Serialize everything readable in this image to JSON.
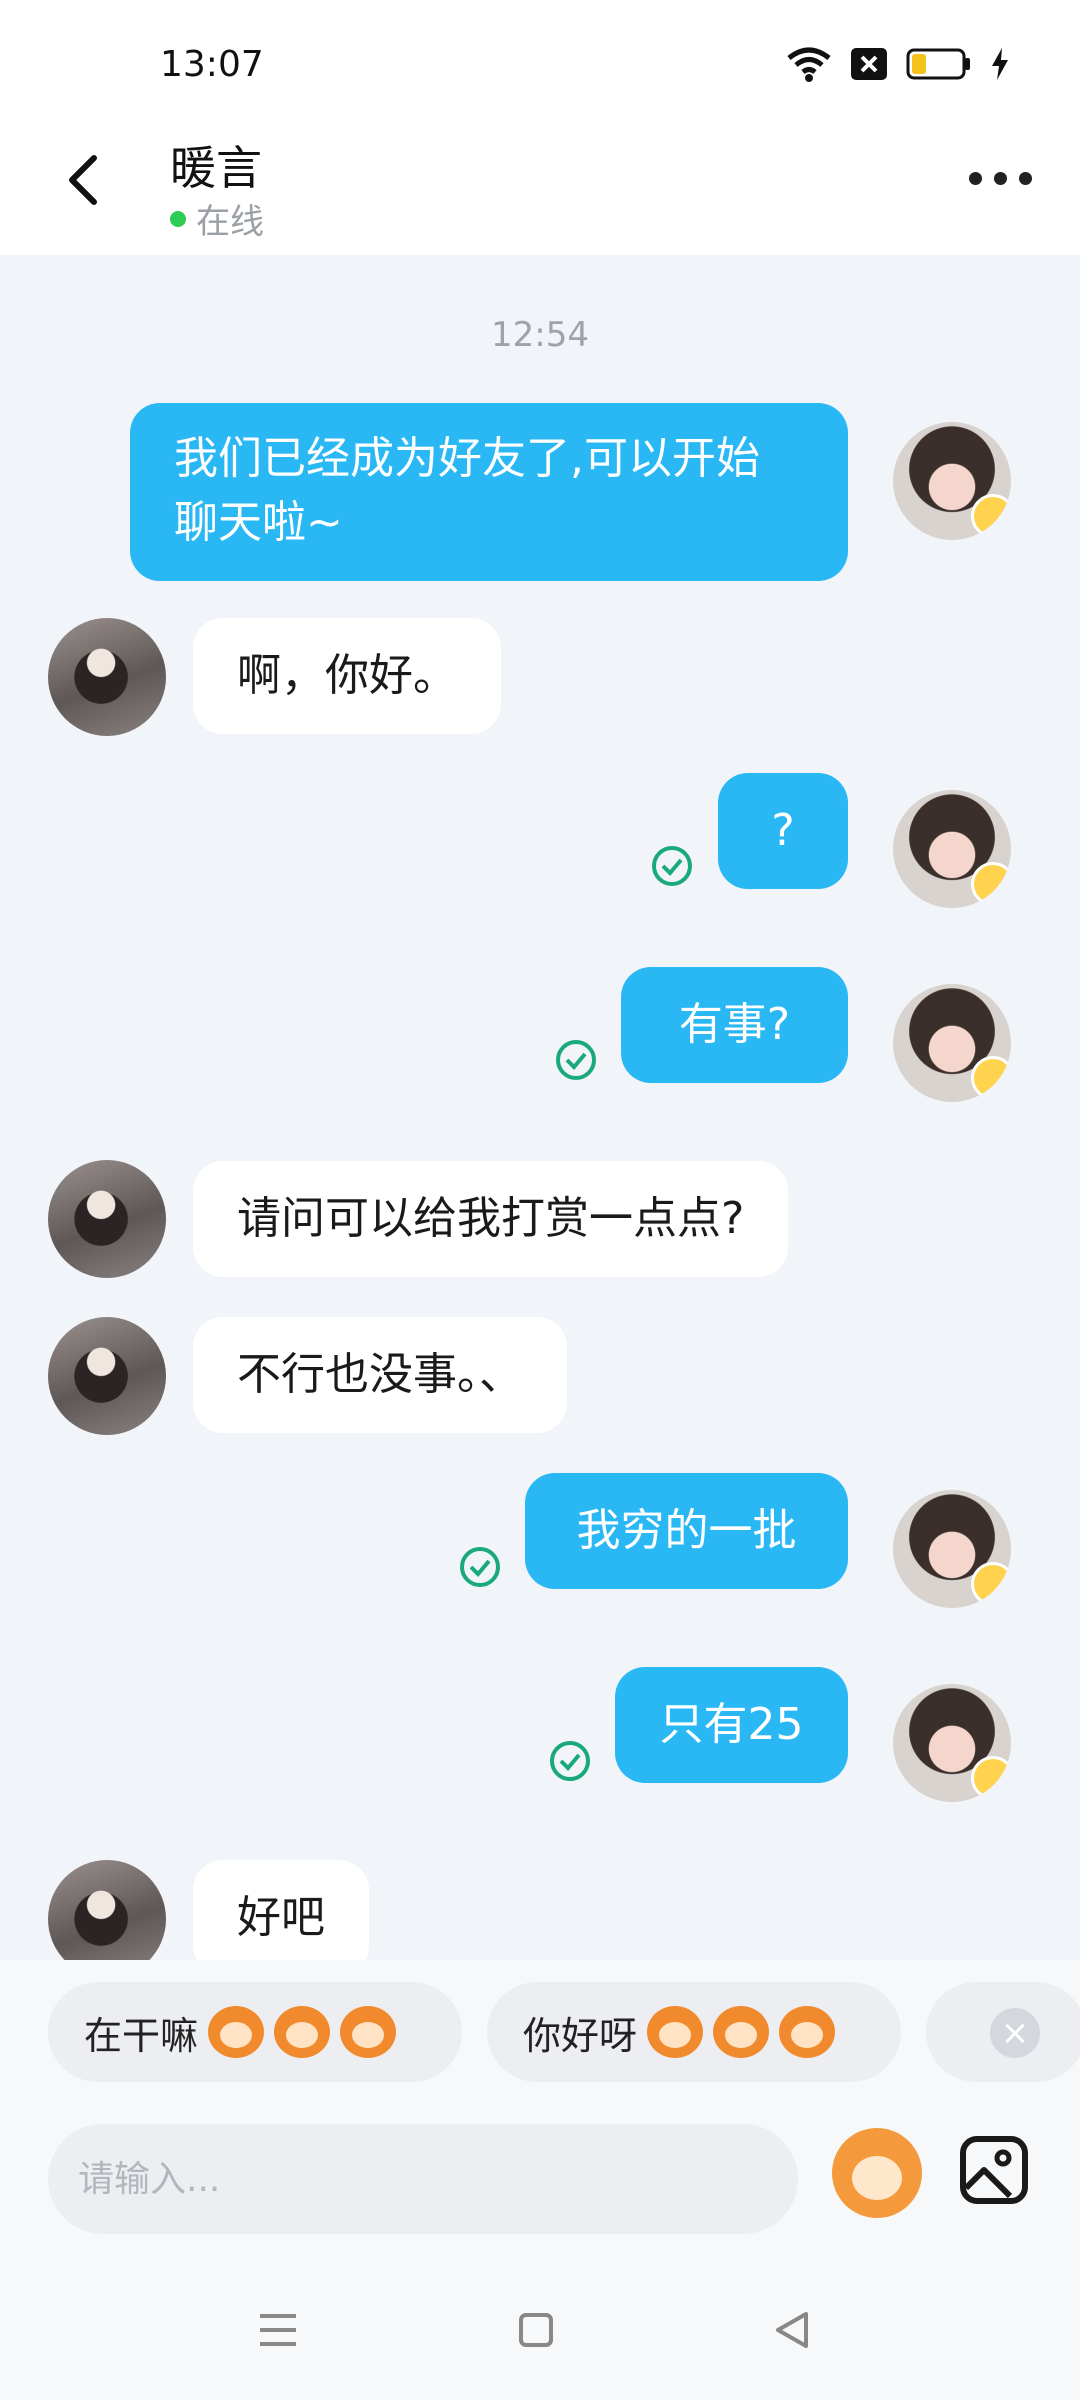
{
  "status": {
    "time": "13:07"
  },
  "header": {
    "name": "暖言",
    "presence": "在线"
  },
  "chat": {
    "timestamp": "12:54",
    "messages": [
      {
        "from": "me",
        "line1": "我们已经成为好友了,可以开始",
        "line2": "聊天啦~"
      },
      {
        "from": "them",
        "text": "啊，你好。"
      },
      {
        "from": "me",
        "text": "?",
        "read": true
      },
      {
        "from": "me",
        "text": "有事?",
        "read": true
      },
      {
        "from": "them",
        "text": "请问可以给我打赏一点点?"
      },
      {
        "from": "them",
        "text": "不行也没事。、"
      },
      {
        "from": "me",
        "text": "我穷的一批",
        "read": true
      },
      {
        "from": "me",
        "text": "只有25",
        "read": true
      },
      {
        "from": "them",
        "text": "好吧"
      }
    ]
  },
  "quick_replies": [
    {
      "text": "在干嘛",
      "emoji": "monkey-grin-icon"
    },
    {
      "text": "你好呀",
      "emoji": "monkey-face-icon"
    }
  ],
  "input": {
    "placeholder": "请输入..."
  },
  "colors": {
    "my_bubble": "#2ab8f5",
    "their_bubble": "#ffffff",
    "read_check": "#19a97b",
    "online_dot": "#2ecc55"
  }
}
